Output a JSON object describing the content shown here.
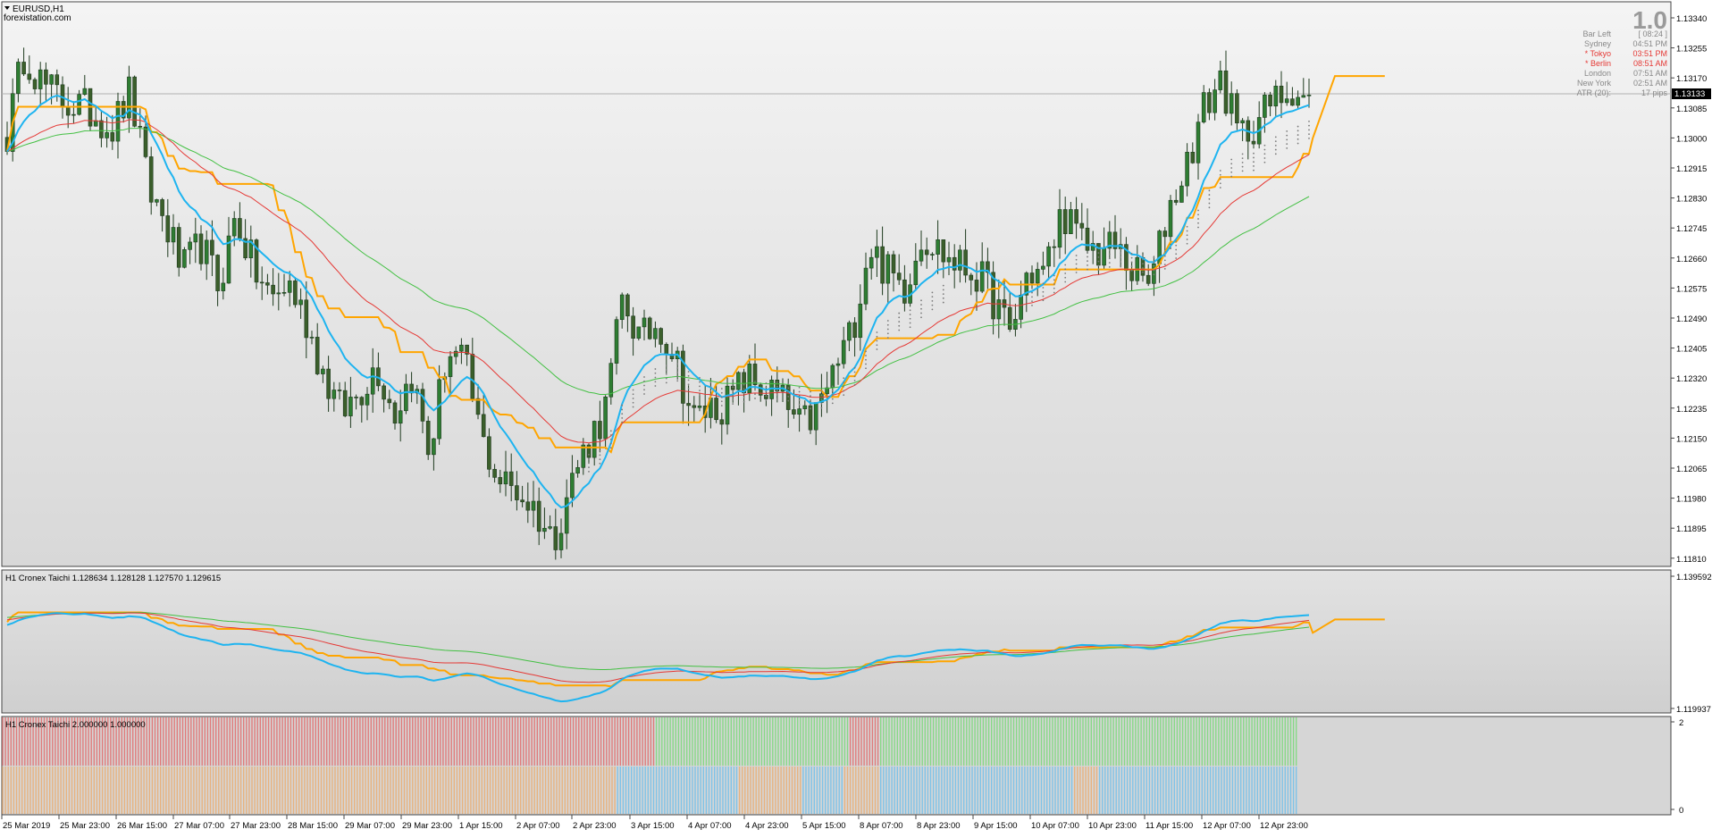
{
  "main": {
    "symbol": "EURUSD,H1",
    "watermark": "forexistation.com",
    "big_number": "1.0",
    "info_panel": [
      {
        "label": "Bar Left",
        "value": "[ 08:24 ]",
        "color": "#888888"
      },
      {
        "label": "Sydney",
        "value": "04:51 PM",
        "color": "#888888"
      },
      {
        "label": "* Tokyo",
        "value": "03:51 PM",
        "color": "#e53935"
      },
      {
        "label": "* Berlin",
        "value": "08:51 AM",
        "color": "#e53935"
      },
      {
        "label": "London",
        "value": "07:51 AM",
        "color": "#888888"
      },
      {
        "label": "New York",
        "value": "02:51 AM",
        "color": "#888888"
      },
      {
        "label": "ATR (20):",
        "value": "17 pips",
        "color": "#888888"
      }
    ],
    "current_price": "1.13133",
    "y_ticks": [
      "1.13340",
      "1.13255",
      "1.13170",
      "1.13085",
      "1.13000",
      "1.12915",
      "1.12830",
      "1.12745",
      "1.12660",
      "1.12575",
      "1.12490",
      "1.12405",
      "1.12320",
      "1.12235",
      "1.12150",
      "1.12065",
      "1.11980",
      "1.11895",
      "1.11810"
    ]
  },
  "sub1": {
    "label": "H1 Cronex Taichi 1.128634 1.128128 1.127570 1.129615",
    "y_ticks": [
      "1.139592",
      "1.119937"
    ]
  },
  "sub2": {
    "label": "H1 Cronex Taichi 2.000000 1.000000",
    "y_ticks": [
      "2",
      "0"
    ]
  },
  "x_ticks": [
    "25 Mar 2019",
    "25 Mar 23:00",
    "26 Mar 15:00",
    "27 Mar 07:00",
    "27 Mar 23:00",
    "28 Mar 15:00",
    "29 Mar 07:00",
    "29 Mar 23:00",
    "1 Apr 15:00",
    "2 Apr 07:00",
    "2 Apr 23:00",
    "3 Apr 15:00",
    "4 Apr 07:00",
    "4 Apr 23:00",
    "5 Apr 15:00",
    "8 Apr 07:00",
    "8 Apr 23:00",
    "9 Apr 15:00",
    "10 Apr 07:00",
    "10 Apr 23:00",
    "11 Apr 15:00",
    "12 Apr 07:00",
    "12 Apr 23:00"
  ],
  "colors": {
    "background": "#e8e8e8",
    "bull_candle": "#2e7d32",
    "bear_candle": "#2e4a2e",
    "orange": "#ffa500",
    "blue": "#1eb4f0",
    "red": "#e53935",
    "green": "#43c043",
    "dots": "#7a7a7a",
    "hist_red": "#e07a7a",
    "hist_green": "#86d986",
    "hist_orange": "#e8b27e",
    "hist_blue": "#7ec3e8"
  },
  "chart_data": {
    "type": "candlestick",
    "series": [
      {
        "name": "EURUSD,H1",
        "kind": "candle",
        "close_path": [
          1.1301,
          1.1325,
          1.1315,
          1.1311,
          1.1309,
          1.1307,
          1.1303,
          1.1313,
          1.1286,
          1.1276,
          1.1262,
          1.127,
          1.1258,
          1.1278,
          1.1263,
          1.1254,
          1.1259,
          1.1248,
          1.1233,
          1.1222,
          1.1228,
          1.1236,
          1.1222,
          1.1233,
          1.121,
          1.124,
          1.1236,
          1.1214,
          1.1203,
          1.12,
          1.1195,
          1.1186,
          1.1202,
          1.1214,
          1.1223,
          1.1255,
          1.1242,
          1.1248,
          1.1238,
          1.122,
          1.1224,
          1.1225,
          1.1232,
          1.1229,
          1.1226,
          1.1218,
          1.1222,
          1.1234,
          1.1245,
          1.127,
          1.1262,
          1.1258,
          1.1273,
          1.1268,
          1.1264,
          1.1262,
          1.1255,
          1.1244,
          1.1262,
          1.1262,
          1.128,
          1.127,
          1.1268,
          1.1269,
          1.1262,
          1.1258,
          1.128,
          1.1292,
          1.1308,
          1.1317,
          1.13,
          1.1305,
          1.131,
          1.1315,
          1.131
        ]
      }
    ]
  }
}
